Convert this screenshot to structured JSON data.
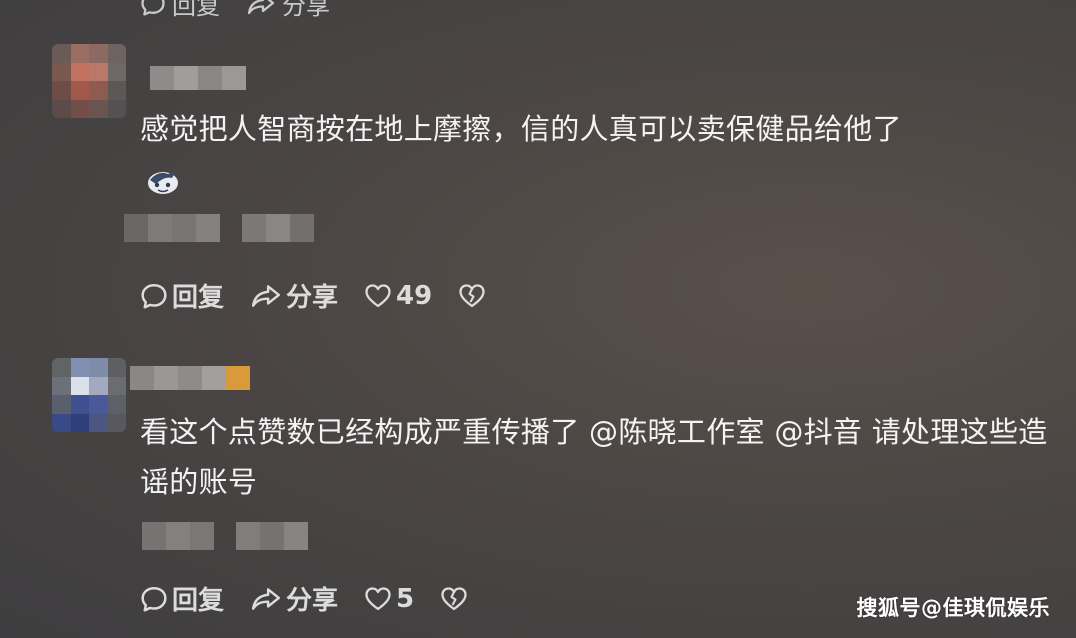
{
  "top_bar": {
    "reply_label": "回复",
    "share_label": "分享"
  },
  "comments": [
    {
      "text": "感觉把人智商按在地上摩擦，信的人真可以卖保健品给他了",
      "has_emoji": true,
      "actions": {
        "reply_label": "回复",
        "share_label": "分享",
        "like_count": "49"
      }
    },
    {
      "text": "看这个点赞数已经构成严重传播了 @陈晓工作室  @抖音  请处理这些造谣的账号",
      "has_emoji": false,
      "actions": {
        "reply_label": "回复",
        "share_label": "分享",
        "like_count": "5"
      }
    }
  ],
  "watermark": "搜狐号@佳琪侃娱乐",
  "icons": {
    "reply": "comment-bubble-icon",
    "share": "share-arrow-icon",
    "like": "heart-icon",
    "dislike": "broken-heart-icon",
    "emoji": "emoji-sticker-icon"
  },
  "colors": {
    "background": "#47423f",
    "text": "#f3f3f3",
    "action_text": "#dcdcdc"
  }
}
